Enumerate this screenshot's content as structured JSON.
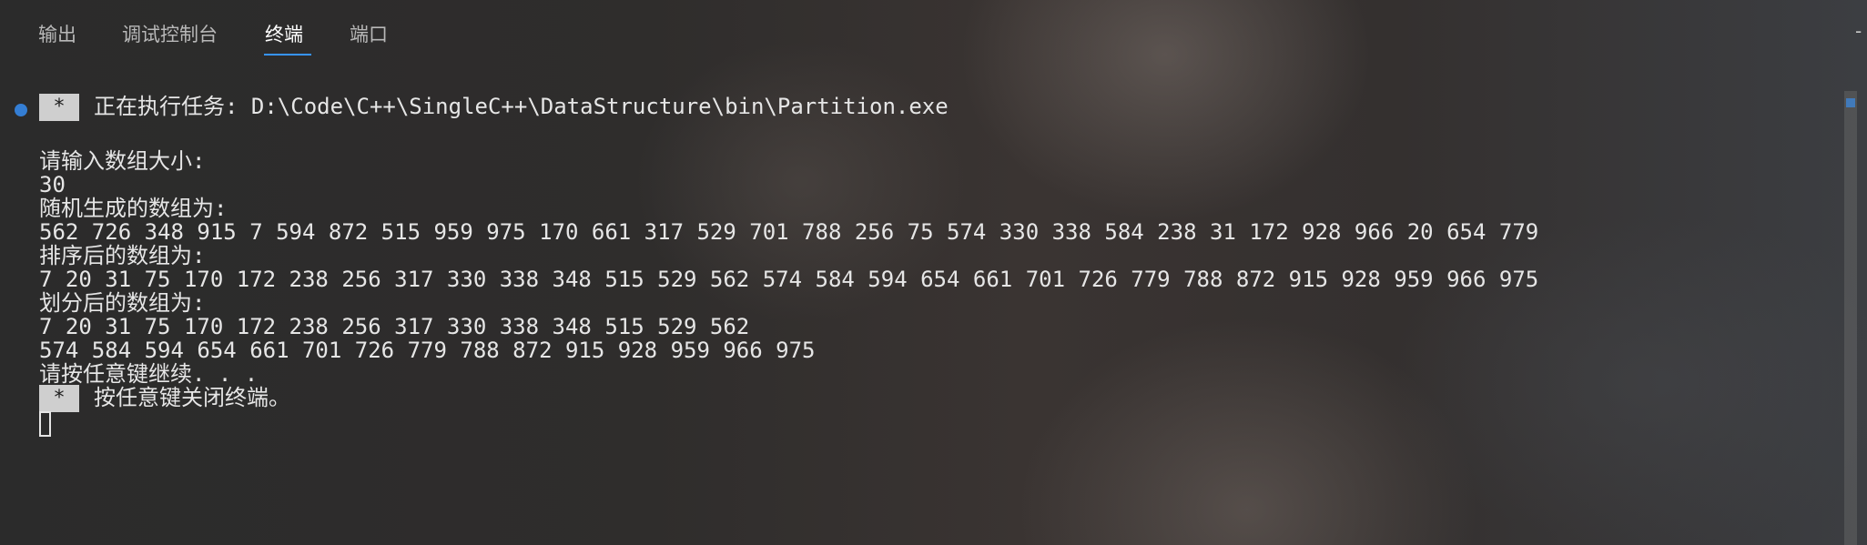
{
  "tabs": [
    {
      "label": "输出"
    },
    {
      "label": "调试控制台"
    },
    {
      "label": "终端"
    },
    {
      "label": "端口"
    }
  ],
  "corner_glyph": "-",
  "terminal": {
    "task_badge": "*",
    "task_line": "正在执行任务: D:\\Code\\C++\\SingleC++\\DataStructure\\bin\\Partition.exe",
    "lines": [
      "请输入数组大小:",
      "30",
      "随机生成的数组为:",
      "562 726 348 915 7 594 872 515 959 975 170 661 317 529 701 788 256 75 574 330 338 584 238 31 172 928 966 20 654 779",
      "排序后的数组为:",
      "7 20 31 75 170 172 238 256 317 330 338 348 515 529 562 574 584 594 654 661 701 726 779 788 872 915 928 959 966 975",
      "划分后的数组为:",
      "7 20 31 75 170 172 238 256 317 330 338 348 515 529 562",
      "574 584 594 654 661 701 726 779 788 872 915 928 959 966 975",
      "请按任意键继续. . ."
    ],
    "close_badge": "*",
    "close_line": "按任意键关闭终端。"
  },
  "colors": {
    "accent": "#3794ff",
    "text": "#e6e6e6"
  }
}
